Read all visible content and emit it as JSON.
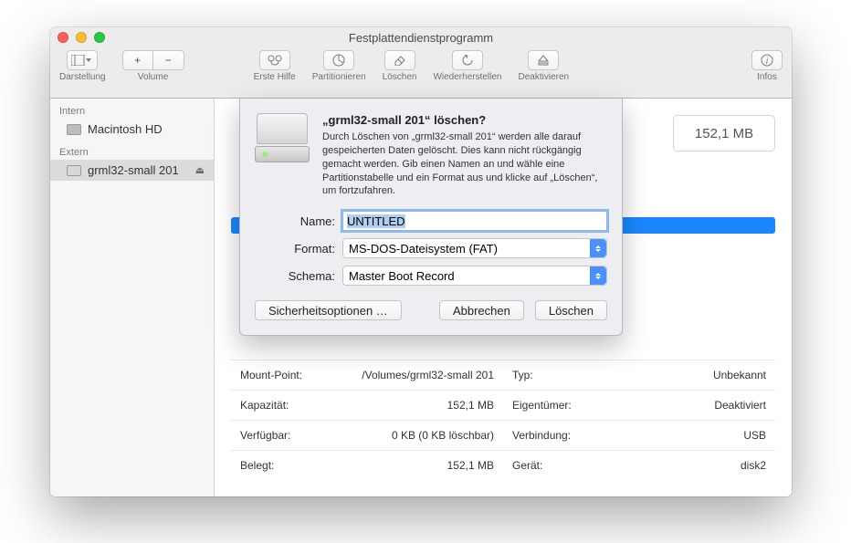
{
  "window": {
    "title": "Festplattendienstprogramm"
  },
  "toolbar": {
    "view": "Darstellung",
    "volume": "Volume",
    "firstaid": "Erste Hilfe",
    "partition": "Partitionieren",
    "erase": "Löschen",
    "restore": "Wiederherstellen",
    "unmount": "Deaktivieren",
    "info": "Infos"
  },
  "sidebar": {
    "internal_header": "Intern",
    "external_header": "Extern",
    "items": [
      {
        "label": "Macintosh HD"
      },
      {
        "label": "grml32-small 201"
      }
    ]
  },
  "main": {
    "size": "152,1 MB"
  },
  "info": {
    "left": [
      {
        "k": "Mount-Point:",
        "v": "/Volumes/grml32-small 201"
      },
      {
        "k": "Kapazität:",
        "v": "152,1 MB"
      },
      {
        "k": "Verfügbar:",
        "v": "0 KB (0 KB löschbar)"
      },
      {
        "k": "Belegt:",
        "v": "152,1 MB"
      }
    ],
    "right": [
      {
        "k": "Typ:",
        "v": "Unbekannt"
      },
      {
        "k": "Eigentümer:",
        "v": "Deaktiviert"
      },
      {
        "k": "Verbindung:",
        "v": "USB"
      },
      {
        "k": "Gerät:",
        "v": "disk2"
      }
    ]
  },
  "sheet": {
    "title": "„grml32-small 201“ löschen?",
    "body": "Durch Löschen von „grml32-small 201“ werden alle darauf gespeicherten Daten gelöscht. Dies kann nicht rückgängig gemacht werden. Gib einen Namen an und wähle eine Partitionstabelle und ein Format aus und klicke auf „Löschen“, um fortzufahren.",
    "name_label": "Name:",
    "name_value": "UNTITLED",
    "format_label": "Format:",
    "format_value": "MS-DOS-Dateisystem (FAT)",
    "scheme_label": "Schema:",
    "scheme_value": "Master Boot Record",
    "security": "Sicherheitsoptionen …",
    "cancel": "Abbrechen",
    "erase": "Löschen"
  }
}
